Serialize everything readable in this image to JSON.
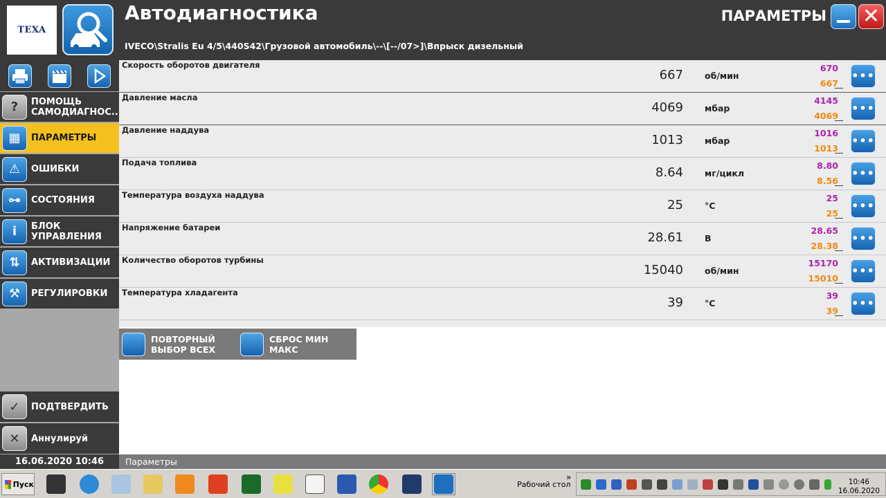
{
  "header": {
    "logo": "TEXA",
    "title": "Автодиагностика",
    "path": "IVECO\\Stralis Eu 4/5\\440S42\\Грузовой автомобиль\\--\\[--/07>]\\Впрыск дизельный",
    "section": "ПАРАМЕТРЫ",
    "minimize_icon": "minimize-icon",
    "close_icon": "close-icon",
    "close_glyph": "✕"
  },
  "toolbar": {
    "icons": [
      "printer-icon",
      "clapperboard-icon",
      "play-icon"
    ]
  },
  "sidebar": {
    "items": [
      {
        "label": "ПОМОЩЬ\nСАМОДИАГНОС...",
        "icon": "help-icon",
        "glyph": "?"
      },
      {
        "label": "ПАРАМЕТРЫ",
        "icon": "grid-icon",
        "glyph": "▦",
        "active": true
      },
      {
        "label": "ОШИБКИ",
        "icon": "warning-icon",
        "glyph": "⚠"
      },
      {
        "label": "СОСТОЯНИЯ",
        "icon": "switch-icon",
        "glyph": "⊶"
      },
      {
        "label": "БЛОК\nУПРАВЛЕНИЯ",
        "icon": "info-icon",
        "glyph": "i"
      },
      {
        "label": "АКТИВИЗАЦИИ",
        "icon": "actuator-icon",
        "glyph": "⇅"
      },
      {
        "label": "РЕГУЛИРОВКИ",
        "icon": "tools-icon",
        "glyph": "⚒"
      }
    ],
    "confirm": {
      "label": "ПОДТВЕРДИТЬ",
      "glyph": "✓"
    },
    "cancel": {
      "label": "Аннулируй",
      "glyph": "✕"
    },
    "datetime": "16.06.2020  10:46"
  },
  "status": {
    "text": "Параметры"
  },
  "parameters": [
    {
      "name": "Скорость оборотов двигателя",
      "value": "667",
      "unit": "об/мин",
      "max": "670",
      "min": "667"
    },
    {
      "name": "Давление масла",
      "value": "4069",
      "unit": "мбар",
      "max": "4145",
      "min": "4069"
    },
    {
      "name": "Давление наддува",
      "value": "1013",
      "unit": "мбар",
      "max": "1016",
      "min": "1013"
    },
    {
      "name": "Подача топлива",
      "value": "8.64",
      "unit": "мг/цикл",
      "max": "8.80",
      "min": "8.56"
    },
    {
      "name": "Температура воздуха наддува",
      "value": "25",
      "unit": "°C",
      "max": "25",
      "min": "25"
    },
    {
      "name": "Напряжение батареи",
      "value": "28.61",
      "unit": "В",
      "max": "28.65",
      "min": "28.38"
    },
    {
      "name": "Количество оборотов турбины",
      "value": "15040",
      "unit": "об/мин",
      "max": "15170",
      "min": "15010"
    },
    {
      "name": "Температура хладагента",
      "value": "39",
      "unit": "°C",
      "max": "39",
      "min": "39"
    }
  ],
  "more_glyph": "•••",
  "actions": {
    "reselect": "ПОВТОРНЫЙ\nВЫБОР ВСЕХ",
    "reset_minmax": "СБРОС МИН МАКС"
  },
  "taskbar": {
    "start": "Пуск",
    "desktop_label": "Рабочий стол",
    "chevron": "»",
    "time": "10:46",
    "date": "16.06.2020"
  },
  "colors": {
    "accent": "#f3c01e",
    "dark": "#3a3a3a",
    "max": "#b020b0",
    "min": "#f08a10"
  }
}
